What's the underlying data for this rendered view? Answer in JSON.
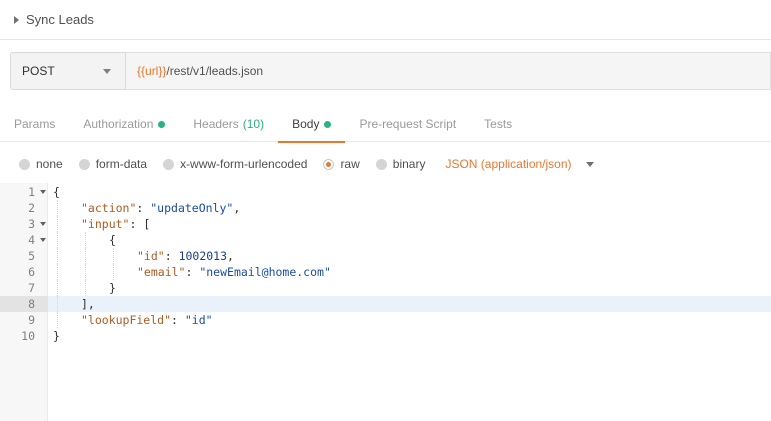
{
  "title": "Sync Leads",
  "request": {
    "method": "POST",
    "url_variable": "{{url}}",
    "url_path": "/rest/v1/leads.json"
  },
  "tabs": [
    {
      "label": "Params",
      "dot": false,
      "count": ""
    },
    {
      "label": "Authorization",
      "dot": true,
      "count": ""
    },
    {
      "label": "Headers",
      "dot": false,
      "count": "(10)"
    },
    {
      "label": "Body",
      "dot": true,
      "count": "",
      "active": true
    },
    {
      "label": "Pre-request Script",
      "dot": false,
      "count": ""
    },
    {
      "label": "Tests",
      "dot": false,
      "count": ""
    }
  ],
  "body_options": {
    "none": "none",
    "form_data": "form-data",
    "urlencoded": "x-www-form-urlencoded",
    "raw": "raw",
    "binary": "binary",
    "format": "JSON (application/json)",
    "selected": "raw"
  },
  "editor": {
    "line_numbers": [
      "1",
      "2",
      "3",
      "4",
      "5",
      "6",
      "7",
      "8",
      "9",
      "10"
    ],
    "highlighted_line": 8,
    "lines": [
      {
        "k": "",
        "v": "",
        "pre": "{",
        "post": ""
      },
      {
        "k": "\"action\"",
        "v": "\"updateOnly\"",
        "pre": "",
        "post": ","
      },
      {
        "k": "\"input\"",
        "v": "",
        "pre": "",
        "post": " ["
      },
      {
        "k": "",
        "v": "",
        "pre": "{",
        "post": ""
      },
      {
        "k": "\"id\"",
        "v": "1002013",
        "pre": "",
        "post": ","
      },
      {
        "k": "\"email\"",
        "v": "\"newEmail@home.com\"",
        "pre": "",
        "post": ""
      },
      {
        "k": "",
        "v": "",
        "pre": "}",
        "post": ""
      },
      {
        "k": "",
        "v": "",
        "pre": "],",
        "post": ""
      },
      {
        "k": "\"lookupField\"",
        "v": "\"id\"",
        "pre": "",
        "post": ""
      },
      {
        "k": "",
        "v": "",
        "pre": "}",
        "post": ""
      }
    ]
  },
  "colors": {
    "accent": "#e8782d",
    "success": "#26b47f"
  }
}
